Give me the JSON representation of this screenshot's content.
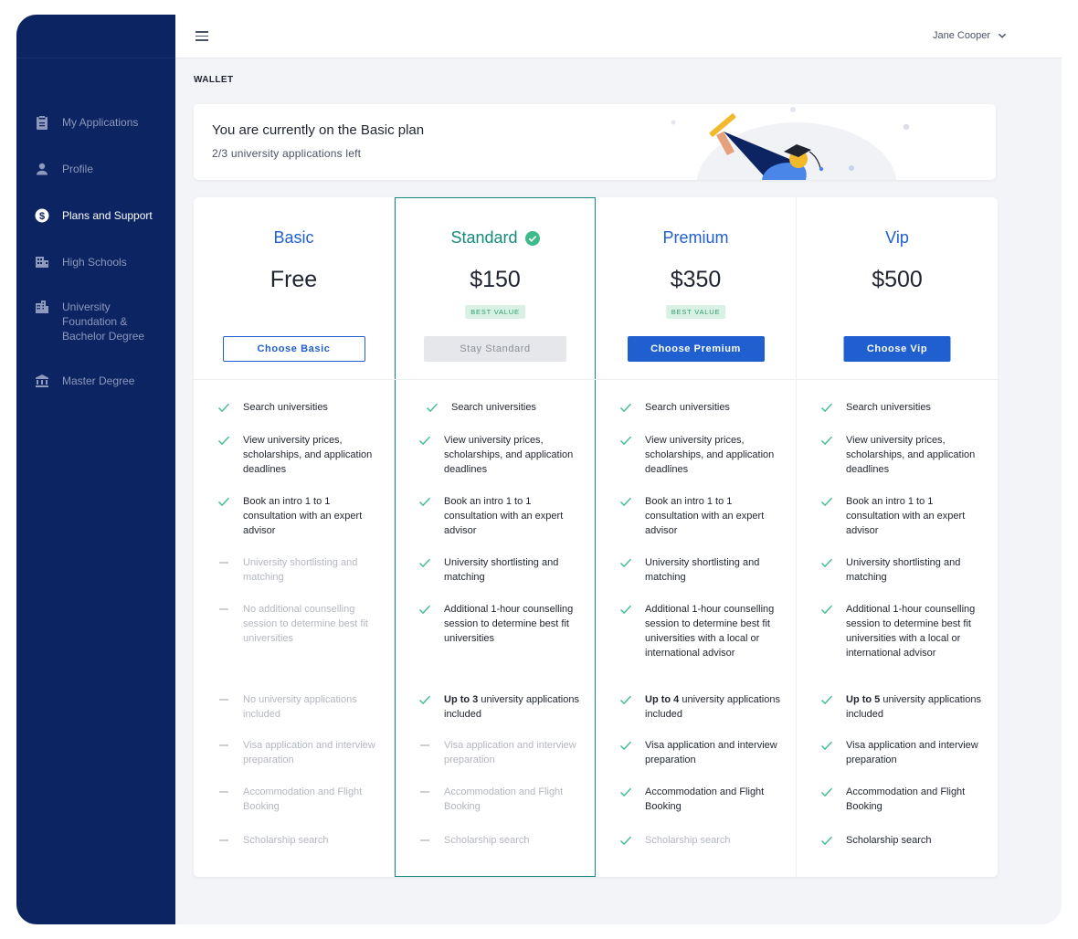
{
  "header": {
    "user_name": "Jane Cooper"
  },
  "sidebar": {
    "items": [
      {
        "label": "My Applications",
        "icon": "clipboard-icon"
      },
      {
        "label": "Profile",
        "icon": "person-icon"
      },
      {
        "label": "Plans and Support",
        "icon": "dollar-circle-icon",
        "active": true
      },
      {
        "label": "High Schools",
        "icon": "building-icon"
      },
      {
        "label": "University Foundation & Bachelor Degree",
        "icon": "city-icon"
      },
      {
        "label": "Master Degree",
        "icon": "bank-icon"
      }
    ]
  },
  "main": {
    "section_title": "WALLET",
    "banner": {
      "title": "You are currently on the Basic plan",
      "subtitle": "2/3 university applications left"
    },
    "plans": [
      {
        "name": "Basic",
        "price": "Free",
        "best_value": "",
        "button": "Choose Basic",
        "features": [
          {
            "text": "Search universities",
            "included": true
          },
          {
            "text": "View university prices, scholarships, and application deadlines",
            "included": true
          },
          {
            "text": "Book an intro 1 to 1 consultation with an expert advisor",
            "included": true
          },
          {
            "text": "University shortlisting and matching",
            "included": false
          },
          {
            "text": "No additional counselling session to determine best fit universities",
            "included": false
          },
          {
            "text": "No university applications included",
            "included": false
          },
          {
            "text": "Visa application and interview preparation",
            "included": false
          },
          {
            "text": "Accommodation and Flight Booking",
            "included": false
          },
          {
            "text": "Scholarship search",
            "included": false
          }
        ]
      },
      {
        "name": "Standard",
        "price": "$150",
        "best_value": "BEST VALUE",
        "button": "Stay Standard",
        "current": true,
        "features": [
          {
            "text": "Search universities",
            "included": true
          },
          {
            "text": "View university prices, scholarships, and application deadlines",
            "included": true
          },
          {
            "text": "Book an intro 1 to 1 consultation with an expert advisor",
            "included": true
          },
          {
            "text": "University shortlisting and matching",
            "included": true
          },
          {
            "text": "Additional 1-hour counselling session to determine best fit universities",
            "included": true
          },
          {
            "bold": "Up to 3",
            "text": " university applications included",
            "included": true
          },
          {
            "text": "Visa application and interview preparation",
            "included": false
          },
          {
            "text": "Accommodation and Flight Booking",
            "included": false
          },
          {
            "text": "Scholarship search",
            "included": false
          }
        ]
      },
      {
        "name": "Premium",
        "price": "$350",
        "best_value": "BEST VALUE",
        "button": "Choose Premium",
        "features": [
          {
            "text": "Search universities",
            "included": true
          },
          {
            "text": "View university prices, scholarships, and application deadlines",
            "included": true
          },
          {
            "text": "Book an intro 1 to 1 consultation with an expert advisor",
            "included": true
          },
          {
            "text": "University shortlisting and matching",
            "included": true
          },
          {
            "text": "Additional 1-hour counselling session to determine best fit universities with a local or international advisor",
            "included": true
          },
          {
            "bold": "Up to 4",
            "text": " university applications included",
            "included": true
          },
          {
            "text": "Visa application and interview preparation",
            "included": true
          },
          {
            "text": "Accommodation and Flight Booking",
            "included": true
          },
          {
            "text": "Scholarship search",
            "included": true,
            "greyed": true
          }
        ]
      },
      {
        "name": "Vip",
        "price": "$500",
        "best_value": "",
        "button": "Choose Vip",
        "features": [
          {
            "text": "Search universities",
            "included": true
          },
          {
            "text": "View university prices, scholarships, and application deadlines",
            "included": true
          },
          {
            "text": "Book an intro 1 to 1 consultation with an expert advisor",
            "included": true
          },
          {
            "text": "University shortlisting and matching",
            "included": true
          },
          {
            "text": "Additional 1-hour counselling session to determine best fit universities with a local or international advisor",
            "included": true
          },
          {
            "bold": "Up to 5",
            "text": " university applications included",
            "included": true
          },
          {
            "text": "Visa application and interview preparation",
            "included": true
          },
          {
            "text": "Accommodation and Flight Booking",
            "included": true
          },
          {
            "text": "Scholarship search",
            "included": true
          }
        ]
      }
    ]
  },
  "colors": {
    "sidebar_bg": "#0c2461",
    "accent_blue": "#1f5fd0",
    "current_plan_teal": "#138a7b",
    "check_green": "#3dbb8a",
    "best_value_bg": "#d9f1e5"
  }
}
